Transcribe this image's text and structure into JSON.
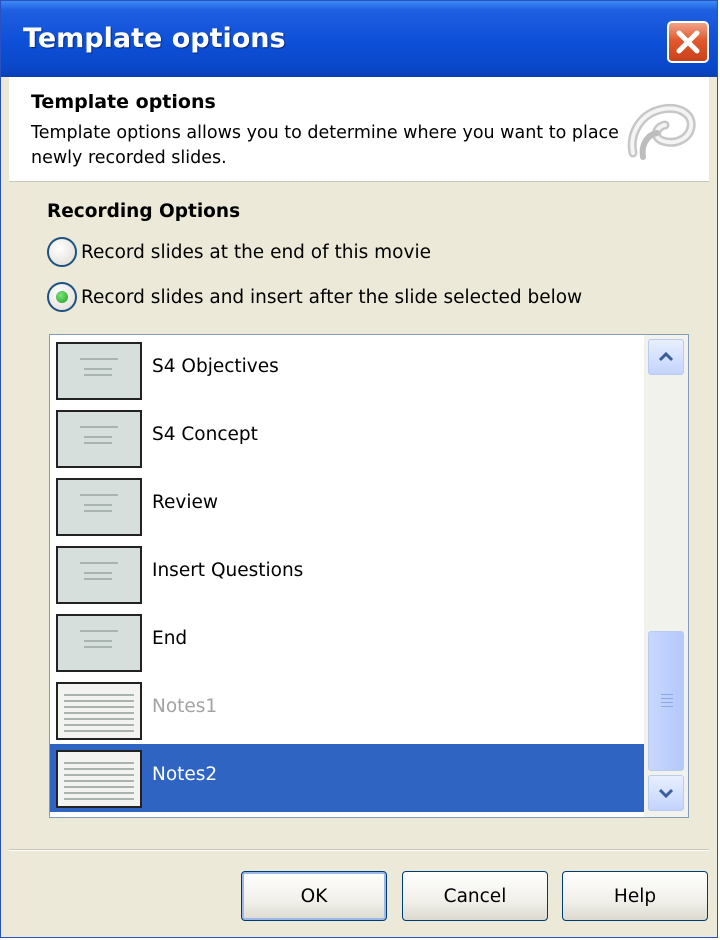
{
  "window": {
    "title": "Template options"
  },
  "header": {
    "title": "Template options",
    "description": "Template options allows you to determine where you want to place newly recorded slides."
  },
  "recording": {
    "section_label": "Recording Options",
    "options": [
      {
        "label": "Record slides at the end of this movie",
        "checked": false
      },
      {
        "label": "Record slides and insert after the slide selected below",
        "checked": true
      }
    ]
  },
  "slides": [
    {
      "label": "S4 Objectives",
      "thumb": "content",
      "state": "normal"
    },
    {
      "label": "S4 Concept",
      "thumb": "content",
      "state": "normal"
    },
    {
      "label": "Review",
      "thumb": "content",
      "state": "normal"
    },
    {
      "label": "Insert Questions",
      "thumb": "content",
      "state": "normal"
    },
    {
      "label": "End",
      "thumb": "content",
      "state": "normal"
    },
    {
      "label": "Notes1",
      "thumb": "notes",
      "state": "disabled"
    },
    {
      "label": "Notes2",
      "thumb": "notes",
      "state": "selected"
    }
  ],
  "buttons": {
    "ok": "OK",
    "cancel": "Cancel",
    "help": "Help"
  },
  "colors": {
    "titlebar": "#0d4fd8",
    "selection": "#2f64c2",
    "close": "#e2582e",
    "radio_checked": "#1f9a1f"
  }
}
